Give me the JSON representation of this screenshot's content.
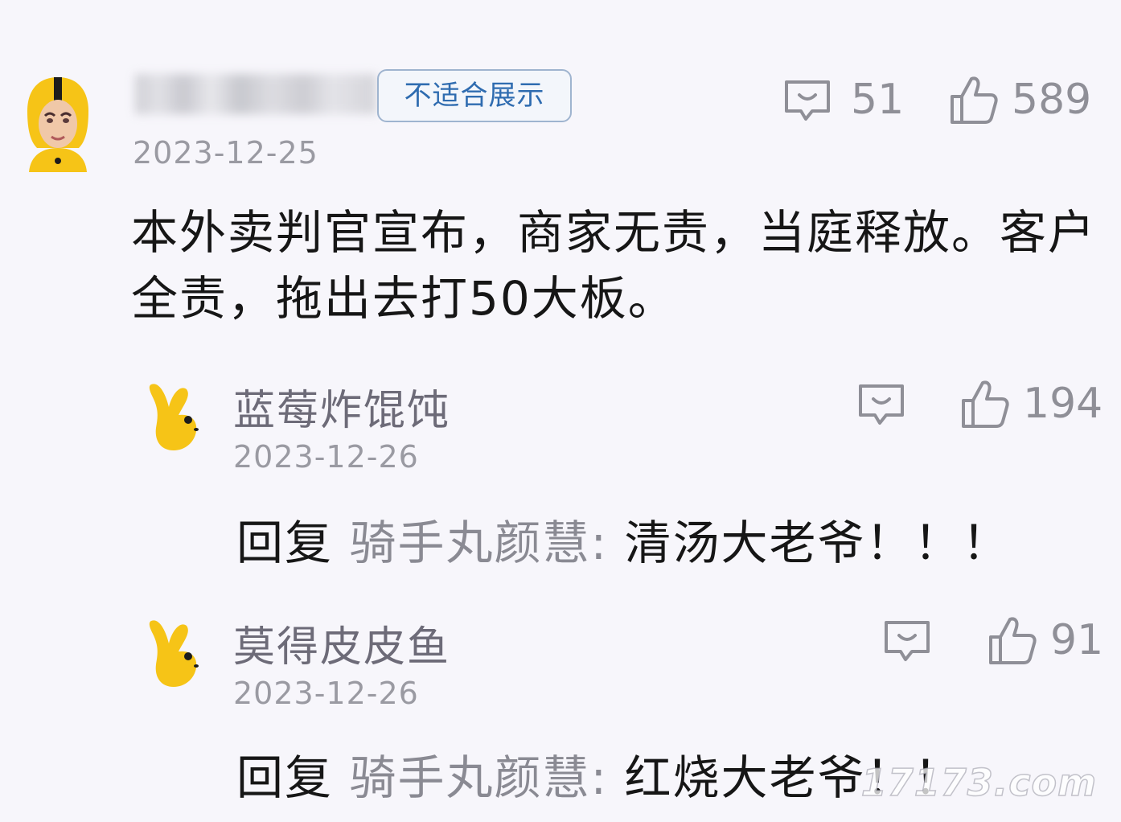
{
  "main_comment": {
    "badge": "不适合展示",
    "date": "2023-12-25",
    "comment_count": "51",
    "like_count": "589",
    "text": "本外卖判官宣布，商家无责，当庭释放。客户全责，拖出去打50大板。"
  },
  "replies": [
    {
      "username": "蓝莓炸馄饨",
      "date": "2023-12-26",
      "like_count": "194",
      "reply_label": "回复",
      "reply_target": "骑手丸颜慧:",
      "reply_text": "清汤大老爷！！！"
    },
    {
      "username": "莫得皮皮鱼",
      "date": "2023-12-26",
      "like_count": "91",
      "reply_label": "回复",
      "reply_target": "骑手丸颜慧:",
      "reply_text": "红烧大老爷！！"
    }
  ],
  "watermark": "17173.com",
  "icons": {
    "comment": "comment-bubble-icon",
    "like": "thumbs-up-icon"
  },
  "colors": {
    "badge_text": "#2f6cb0",
    "badge_border": "#9fb4cf",
    "muted": "#8f8f97",
    "username": "#6d6b78",
    "avatar_yellow": "#f6c417"
  }
}
